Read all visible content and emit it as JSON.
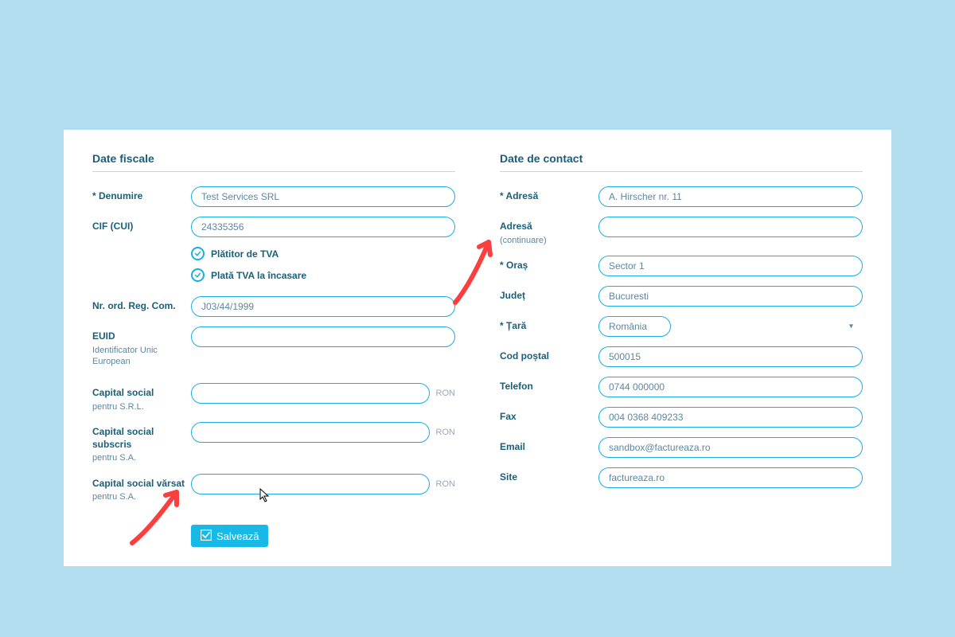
{
  "fiscal": {
    "title": "Date fiscale",
    "name_label": "* Denumire",
    "name_value": "Test Services SRL",
    "cif_label": "CIF (CUI)",
    "cif_value": "24335356",
    "tva_payer": "Plătitor de TVA",
    "tva_cash": "Plată TVA la încasare",
    "regcom_label": "Nr. ord. Reg. Com.",
    "regcom_value": "J03/44/1999",
    "euid_label": "EUID",
    "euid_sub": "Identificator Unic European",
    "euid_value": "",
    "capital_srl_label": "Capital social",
    "capital_srl_sub": "pentru S.R.L.",
    "capital_srl_value": "",
    "capital_sub_label": "Capital social subscris",
    "capital_sub_sub": "pentru S.A.",
    "capital_sub_value": "",
    "capital_varsat_label": "Capital social vărsat",
    "capital_varsat_sub": "pentru S.A.",
    "capital_varsat_value": "",
    "currency": "RON",
    "save": "Salvează"
  },
  "contact": {
    "title": "Date de contact",
    "addr_label": "* Adresă",
    "addr_value": "A. Hirscher nr. 11",
    "addr2_label": "Adresă",
    "addr2_sub": "(continuare)",
    "addr2_value": "",
    "city_label": "* Oraș",
    "city_value": "Sector 1",
    "county_label": "Județ",
    "county_value": "Bucuresti",
    "country_label": "* Țară",
    "country_value": "România",
    "zip_label": "Cod poștal",
    "zip_value": "500015",
    "phone_label": "Telefon",
    "phone_value": "0744 000000",
    "fax_label": "Fax",
    "fax_value": "004 0368 409233",
    "email_label": "Email",
    "email_value": "sandbox@factureaza.ro",
    "site_label": "Site",
    "site_value": "factureaza.ro"
  }
}
